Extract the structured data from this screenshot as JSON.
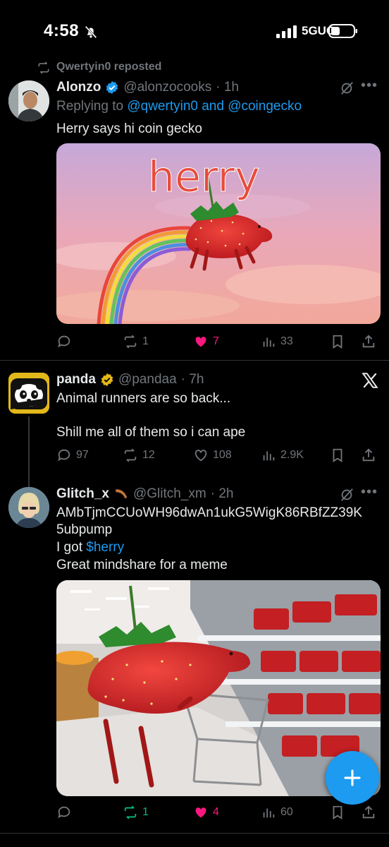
{
  "status_bar": {
    "time": "4:58",
    "network": "5GUC"
  },
  "repost_banner": "Qwertyin0 reposted",
  "tweets": [
    {
      "name": "Alonzo",
      "handle": "@alonzocooks",
      "time": "· 1h",
      "reply_prefix": "Replying to ",
      "reply_to": "@qwertyin0 and @coingecko",
      "text": "Herry says hi coin gecko",
      "image_caption": "herry",
      "replies": "",
      "reposts": "1",
      "likes": "7",
      "views": "33"
    },
    {
      "name": "panda",
      "handle": "@pandaa",
      "time": "· 7h",
      "text_line1": "Animal runners are so back...",
      "text_line2": "Shill me all of them so i can ape",
      "replies": "97",
      "reposts": "12",
      "likes": "108",
      "views": "2.9K"
    },
    {
      "name": "Glitch_x",
      "handle": "@Glitch_xm",
      "time": "· 2h",
      "text_line1": "AMbTjmCCUoWH96dwAn1ukG5WigK86RBfZZ39K",
      "text_line2": "5ubpump",
      "text_line3_prefix": "I got ",
      "text_line3_cashtag": "$herry",
      "text_line4": "Great mindshare for a meme",
      "replies": "",
      "reposts": "1",
      "likes": "4",
      "views": "60"
    }
  ],
  "colors": {
    "accent": "#1d9bf0",
    "like": "#f91880",
    "repost": "#00ba7c",
    "muted": "#71767b",
    "verified_gold": "#e2b719"
  },
  "icons": [
    "mute-bell-icon",
    "signal-icon",
    "battery-icon",
    "repost-icon",
    "verified-badge-icon",
    "grok-icon",
    "more-icon",
    "reply-icon",
    "like-icon",
    "views-icon",
    "bookmark-icon",
    "share-icon",
    "x-logo-icon",
    "compose-plus-icon"
  ]
}
